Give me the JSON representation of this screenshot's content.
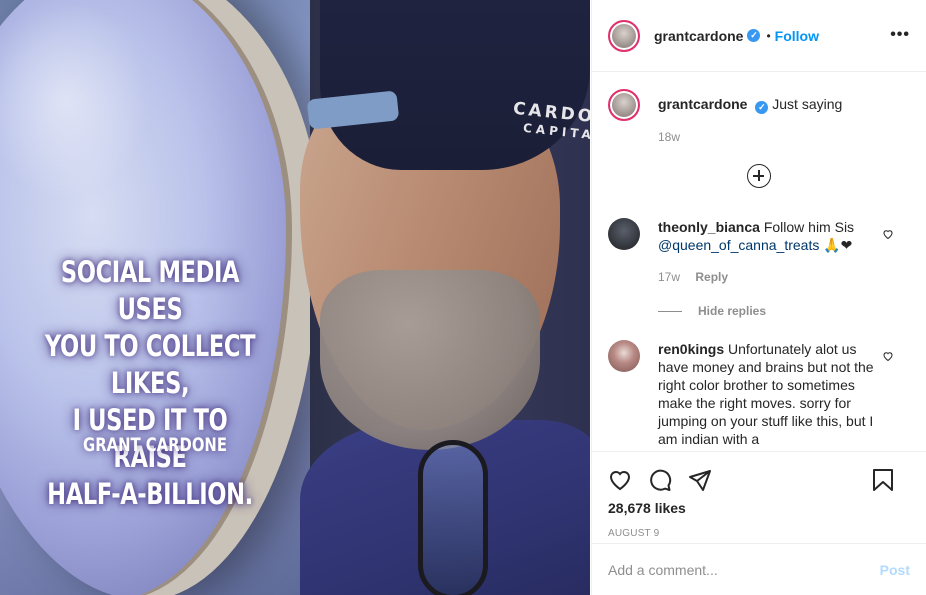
{
  "post_image": {
    "quote_lines": [
      "SOCIAL MEDIA USES",
      "YOU TO COLLECT LIKES,",
      "I USED IT TO RAISE",
      "HALF-A-BILLION."
    ],
    "quote_author": "GRANT CARDONE",
    "hat_text": "CARDO",
    "hat_subtext": "CAPITA"
  },
  "header": {
    "username": "grantcardone",
    "verified_icon": "verified-badge-icon",
    "separator": "•",
    "follow_label": "Follow",
    "more_icon": "•••"
  },
  "caption": {
    "username": "grantcardone",
    "text": "Just saying",
    "time": "18w"
  },
  "comments": [
    {
      "username": "theonly_bianca",
      "text_prefix": "Follow him Sis",
      "mention": "@queen_of_canna_treats",
      "emoji": "🙏❤",
      "time": "17w",
      "reply_label": "Reply"
    },
    {
      "username": "ren0kings",
      "text": "Unfortunately alot us have money and brains but not the right color brother to sometimes make the right moves. sorry for jumping on your stuff like this, but I am indian with a"
    }
  ],
  "hide_replies_label": "Hide replies",
  "actions": {
    "likes": "28,678 likes",
    "date": "AUGUST 9"
  },
  "add_comment": {
    "placeholder": "Add a comment...",
    "post_label": "Post"
  },
  "colors": {
    "link": "#0095f6",
    "post_disabled": "#b3dbff",
    "verified": "#3897f0",
    "heart_red": "#ed4956"
  }
}
